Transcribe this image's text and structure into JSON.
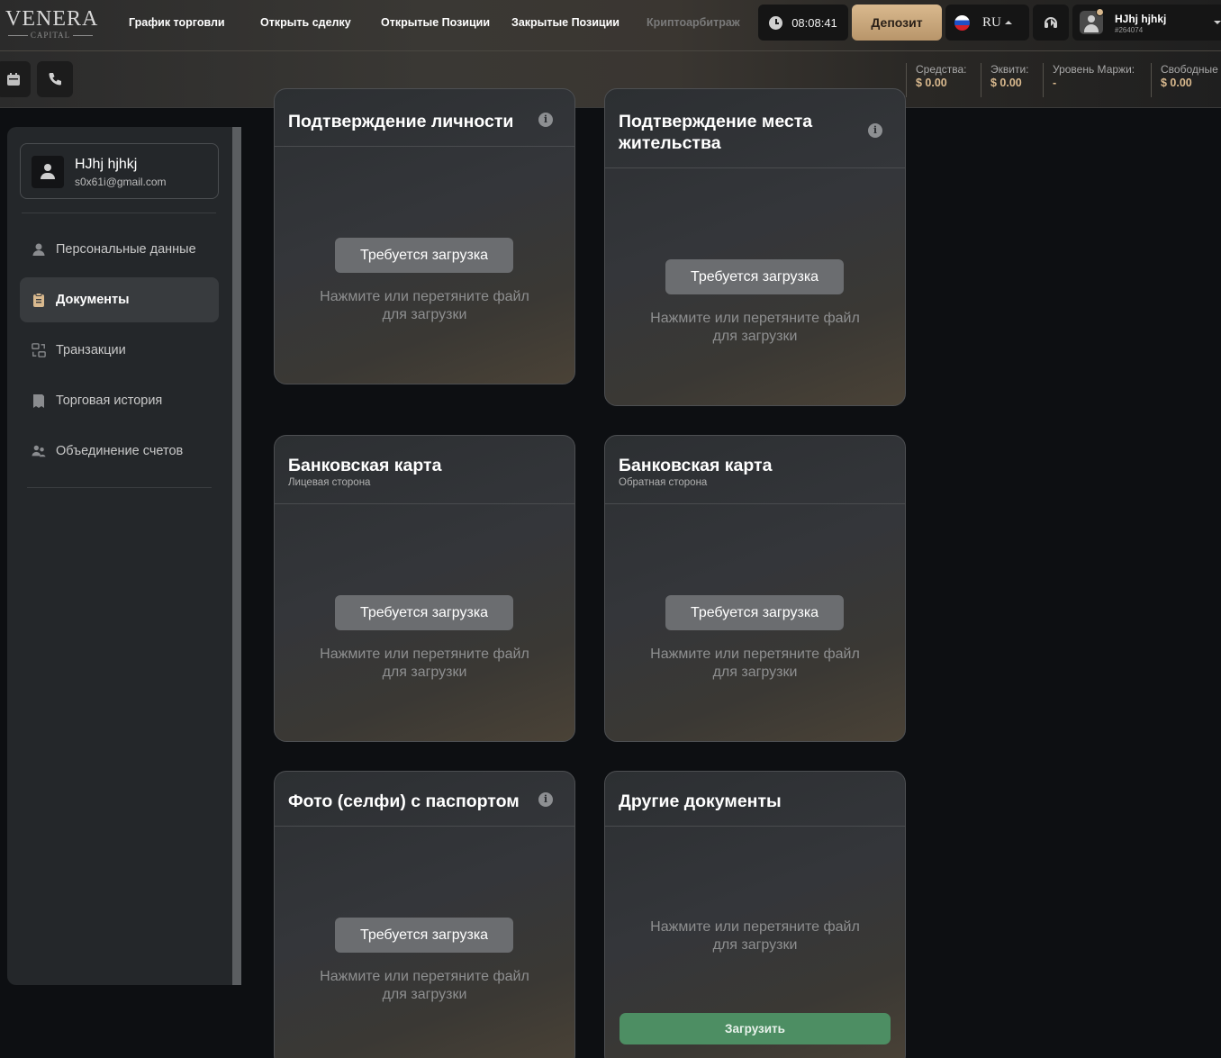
{
  "brand": {
    "name": "VENERA",
    "sub": "CAPITAL"
  },
  "nav": [
    {
      "label": "График торговли"
    },
    {
      "label": "Открыть сделку"
    },
    {
      "label": "Открытые Позиции"
    },
    {
      "label": "Закрытые Позиции"
    },
    {
      "label": "Криптоарбитраж"
    }
  ],
  "header": {
    "time": "08:08:41",
    "deposit_label": "Депозит",
    "language": "RU",
    "user_name": "HJhj hjhkj",
    "user_id": "#264074"
  },
  "stats": [
    {
      "label": "Средства:",
      "value": "$ 0.00"
    },
    {
      "label": "Эквити:",
      "value": "$ 0.00"
    },
    {
      "label": "Уровень Маржи:",
      "value": "-"
    },
    {
      "label": "Свободные",
      "value": "$ 0.00"
    }
  ],
  "profile": {
    "name": "HJhj hjhkj",
    "email": "s0x61i@gmail.com"
  },
  "menu": [
    {
      "label": "Персональные данные",
      "icon": "person-icon"
    },
    {
      "label": "Документы",
      "icon": "clipboard-icon"
    },
    {
      "label": "Транзакции",
      "icon": "transactions-icon"
    },
    {
      "label": "Торговая история",
      "icon": "history-icon"
    },
    {
      "label": "Объединение счетов",
      "icon": "users-icon"
    }
  ],
  "cards": {
    "identity": {
      "title": "Подтверждение личности",
      "button": "Требуется загрузка",
      "hint1": "Нажмите или перетяните файл",
      "hint2": "для загрузки"
    },
    "residence": {
      "title1": "Подтверждение места",
      "title2": "жительства",
      "button": "Требуется загрузка",
      "hint1": "Нажмите или перетяните файл",
      "hint2": "для загрузки"
    },
    "card_front": {
      "title": "Банковская карта",
      "subtitle": "Лицевая сторона",
      "button": "Требуется загрузка",
      "hint1": "Нажмите или перетяните файл",
      "hint2": "для загрузки"
    },
    "card_back": {
      "title": "Банковская карта",
      "subtitle": "Обратная сторона",
      "button": "Требуется загрузка",
      "hint1": "Нажмите или перетяните файл",
      "hint2": "для загрузки"
    },
    "selfie": {
      "title": "Фото (селфи) с паспортом",
      "button": "Требуется загрузка",
      "hint1": "Нажмите или перетяните файл",
      "hint2": "для загрузки"
    },
    "other": {
      "title": "Другие документы",
      "hint1": "Нажмите или перетяните файл",
      "hint2": "для загрузки",
      "upload_label": "Загрузить"
    }
  },
  "colors": {
    "accent_gold": "#d9b98e",
    "upload_green": "#4d8e63"
  }
}
